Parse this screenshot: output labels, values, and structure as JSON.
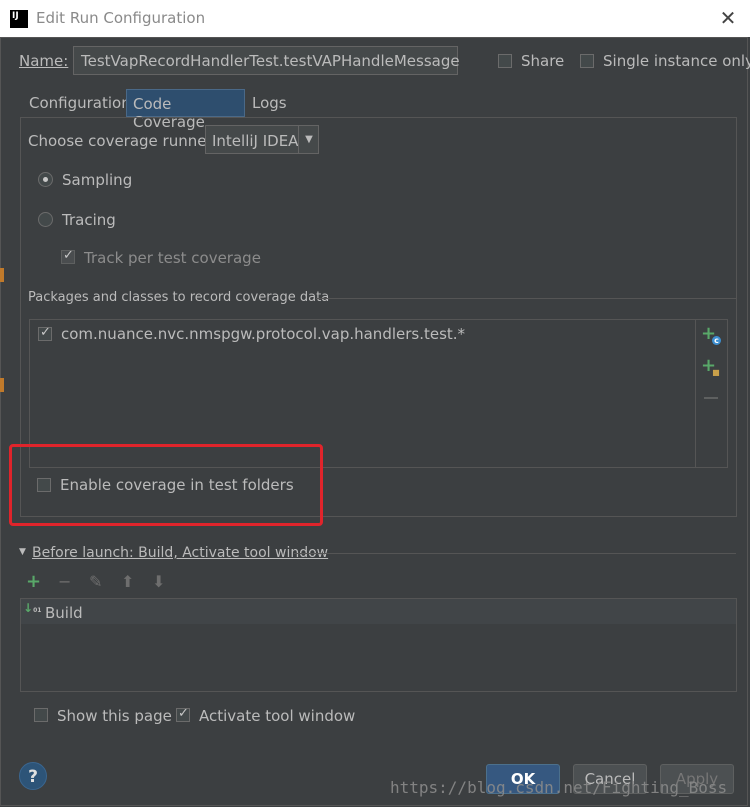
{
  "window": {
    "app_icon_text": "IJ",
    "title": "Edit Run Configuration"
  },
  "header": {
    "name_label": "Name:",
    "name_value": "TestVapRecordHandlerTest.testVAPHandleMessage",
    "share_label": "Share",
    "share_checked": false,
    "single_instance_label": "Single instance only",
    "single_instance_checked": false
  },
  "tabs": [
    {
      "label": "Configuration",
      "active": false
    },
    {
      "label": "Code Coverage",
      "active": true
    },
    {
      "label": "Logs",
      "active": false
    }
  ],
  "coverage": {
    "runner_label": "Choose coverage runner:",
    "runner_value": "IntelliJ IDEA",
    "sampling_label": "Sampling",
    "sampling_selected": true,
    "tracing_label": "Tracing",
    "tracing_selected": false,
    "track_label": "Track per test coverage",
    "track_checked": true,
    "packages_section_label": "Packages and classes to record coverage data",
    "packages": [
      {
        "name": "com.nuance.nvc.nmspgw.protocol.vap.handlers.test.*",
        "checked": true
      }
    ],
    "enable_test_folders_label": "Enable coverage in test folders",
    "enable_test_folders_checked": false
  },
  "before_launch": {
    "header": "Before launch: Build, Activate tool window",
    "items": [
      {
        "label": "Build"
      }
    ]
  },
  "footer": {
    "show_page_label": "Show this page",
    "show_page_checked": false,
    "activate_label": "Activate tool window",
    "activate_checked": true,
    "help_label": "?",
    "ok_label": "OK",
    "cancel_label": "Cancel",
    "apply_label": "Apply"
  },
  "watermark": "https://blog.csdn.net/Fighting_Boss",
  "colors": {
    "background": "#3c3f41",
    "active_tab": "#2e4e6e",
    "highlight": "#e0242b",
    "ok_button": "#365880",
    "add_icon": "#59a869"
  }
}
